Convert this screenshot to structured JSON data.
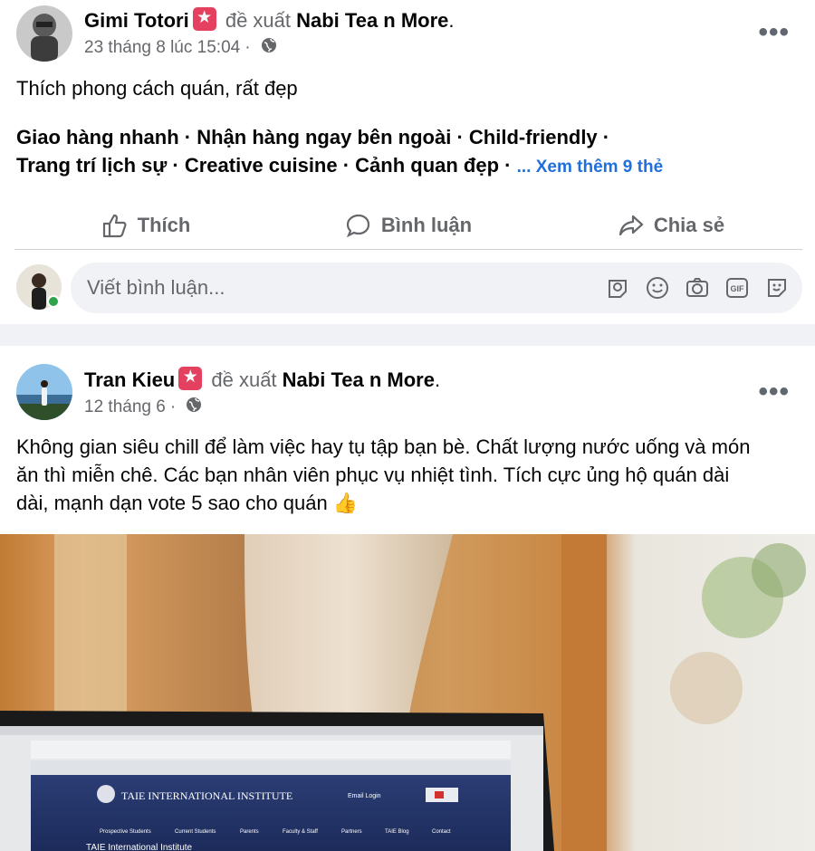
{
  "posts": [
    {
      "author": "Gimi Totori",
      "verb": "đề xuất",
      "page": "Nabi Tea n More",
      "timestamp": "23 tháng 8 lúc 15:04",
      "separator": "·",
      "privacy_icon": "globe-icon",
      "text": "Thích phong cách quán, rất đẹp",
      "tags_line1": "Giao hàng nhanh · Nhận hàng ngay bên ngoài · Child-friendly ·",
      "tags_line2": "Trang trí lịch sự · Creative cuisine · Cảnh quan đẹp ·",
      "see_more": "... Xem thêm 9 thẻ",
      "actions": {
        "like": "Thích",
        "comment": "Bình luận",
        "share": "Chia sẻ"
      },
      "comment_placeholder": "Viết bình luận...",
      "comment_icons": [
        "avatar-sticker-icon",
        "emoji-icon",
        "camera-icon",
        "gif-icon",
        "sticker-icon"
      ]
    },
    {
      "author": "Tran Kieu",
      "verb": "đề xuất",
      "page": "Nabi Tea n More",
      "timestamp": "12 tháng 6",
      "separator": "·",
      "privacy_icon": "globe-icon",
      "text_line1": "Không gian siêu chill để làm việc hay tụ tập bạn bè. Chất lượng nước uống và món",
      "text_line2": "ăn thì miễn chê. Các bạn nhân viên phục vụ nhiệt tình. Tích cực ủng hộ quán dài",
      "text_line3": "dài, mạnh dạn vote 5 sao cho quán",
      "emoji": "👍",
      "photo": {
        "screen_title": "TAIE INTERNATIONAL INSTITUTE",
        "screen_nav": [
          "Prospective Students",
          "Current Students",
          "Parents",
          "Faculty & Staff",
          "Partners",
          "TAIE Blog",
          "Contact"
        ],
        "screen_footer": "TAIE International Institute",
        "screen_login": "Email Login"
      }
    }
  ],
  "colors": {
    "link": "#216fdb",
    "muted": "#65676b",
    "badge": "#e4405f",
    "online": "#31a24c"
  }
}
